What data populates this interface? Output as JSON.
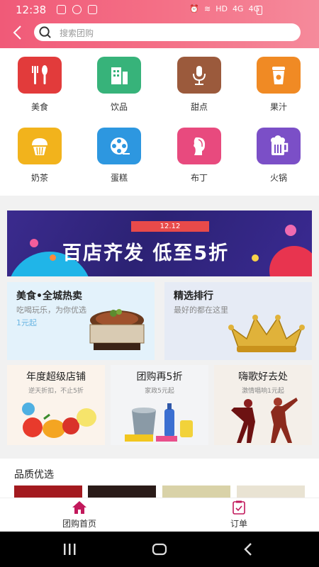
{
  "status": {
    "time": "12:38",
    "network": "HD",
    "signal1": "4G",
    "signal2": "4G"
  },
  "search": {
    "placeholder": "搜索团购"
  },
  "categories": [
    {
      "label": "美食",
      "icon": "cutlery-icon",
      "color": "#e23b3b"
    },
    {
      "label": "饮品",
      "icon": "building-icon",
      "color": "#37b37a"
    },
    {
      "label": "甜点",
      "icon": "microphone-icon",
      "color": "#9b5a3c"
    },
    {
      "label": "果汁",
      "icon": "cup-icon",
      "color": "#f08a24"
    },
    {
      "label": "奶茶",
      "icon": "cupcake-icon",
      "color": "#f2b31c"
    },
    {
      "label": "蛋糕",
      "icon": "film-reel-icon",
      "color": "#2d97e0"
    },
    {
      "label": "布丁",
      "icon": "face-profile-icon",
      "color": "#e84a7e"
    },
    {
      "label": "火锅",
      "icon": "beer-mug-icon",
      "color": "#7b4fc7"
    }
  ],
  "banner": {
    "tag": "12.12",
    "title": "百店齐发  低至5折"
  },
  "cards2": [
    {
      "title": "美食•全城热卖",
      "subtitle": "吃喝玩乐，为你优选",
      "extra": "1元起"
    },
    {
      "title": "精选排行",
      "subtitle": "最好的都在这里"
    }
  ],
  "cards3": [
    {
      "title": "年度超级店铺",
      "subtitle": "逆天折扣，不止5折"
    },
    {
      "title": "团购再5折",
      "subtitle": "家政5元起"
    },
    {
      "title": "嗨歌好去处",
      "subtitle": "激情唱响1元起"
    }
  ],
  "quality": {
    "title": "品质优选"
  },
  "tabs": [
    {
      "label": "团购首页",
      "icon": "home-icon",
      "active": true
    },
    {
      "label": "订单",
      "icon": "order-icon",
      "active": false
    }
  ],
  "colors": {
    "accent": "#f05a78",
    "tab_active": "#c2185b"
  }
}
